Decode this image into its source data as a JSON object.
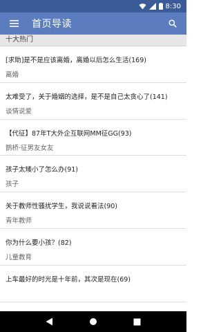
{
  "status_bar": {
    "time": "8:30",
    "wifi_icon": "wifi-icon",
    "signal_icon": "signal-icon",
    "battery_icon": "battery-icon"
  },
  "app_bar": {
    "title": "首页导读",
    "menu_icon": "menu-icon",
    "search_icon": "search-icon",
    "color": "#5b7dbf"
  },
  "section": {
    "header": "十大热门"
  },
  "items": [
    {
      "title": "[求助]是不是应该离婚，离婚以后怎么生活(169)",
      "category": "离婚"
    },
    {
      "title": "太难受了，关于婚姻的选择，是不是自己太贪心了(141)",
      "category": "谈情说爱"
    },
    {
      "title": "【代征】87年T大外企互联网MM征GG(93)",
      "category": "鹊桥·征男友女友"
    },
    {
      "title": "孩子太矮小了怎么办(91)",
      "category": "孩子"
    },
    {
      "title": "关于教师性骚扰学生，我说说看法(90)",
      "category": "青年教师"
    },
    {
      "title": "你为什么要小孩？(82)",
      "category": "儿童教育"
    },
    {
      "title": "上车最好的时光是十年前，其次是现在(69)",
      "category": ""
    }
  ],
  "nav_bar": {
    "back_icon": "back-icon",
    "home_icon": "home-icon",
    "recents_icon": "recents-icon"
  }
}
